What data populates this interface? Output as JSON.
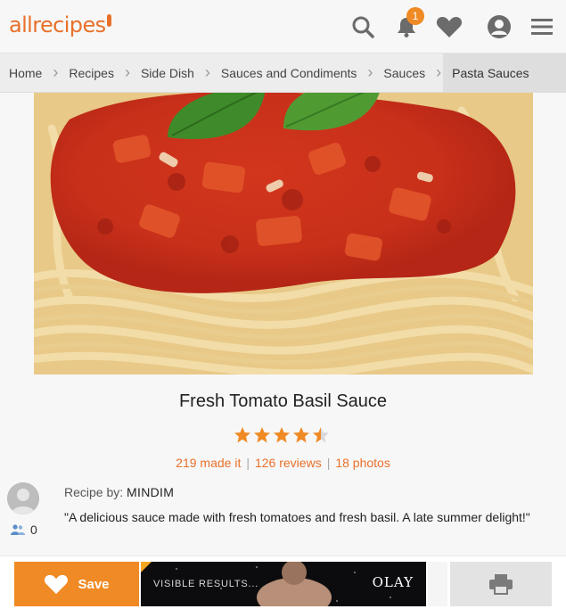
{
  "header": {
    "logo_text": "allrecipes",
    "notification_count": "1",
    "icons": [
      "search-icon",
      "bell-icon",
      "heart-icon",
      "user-icon",
      "menu-icon"
    ],
    "accent_color": "#e8702a"
  },
  "breadcrumb": {
    "items": [
      {
        "label": "Home"
      },
      {
        "label": "Recipes"
      },
      {
        "label": "Side Dish"
      },
      {
        "label": "Sauces and Condiments"
      },
      {
        "label": "Sauces"
      },
      {
        "label": "Pasta Sauces"
      }
    ]
  },
  "recipe": {
    "title": "Fresh Tomato Basil Sauce",
    "rating": 4.5,
    "rating_max": 5,
    "made_it": "219 made it",
    "reviews": "126 reviews",
    "photos": "18 photos",
    "by_label": "Recipe by:",
    "author": "MINDIM",
    "followers": "0",
    "description": "\"A delicious sauce made with fresh tomatoes and fresh basil. A late summer delight!\""
  },
  "bottom_bar": {
    "save_label": "Save",
    "ad_text": "VISIBLE RESULTS...",
    "ad_brand": "OLAY"
  }
}
